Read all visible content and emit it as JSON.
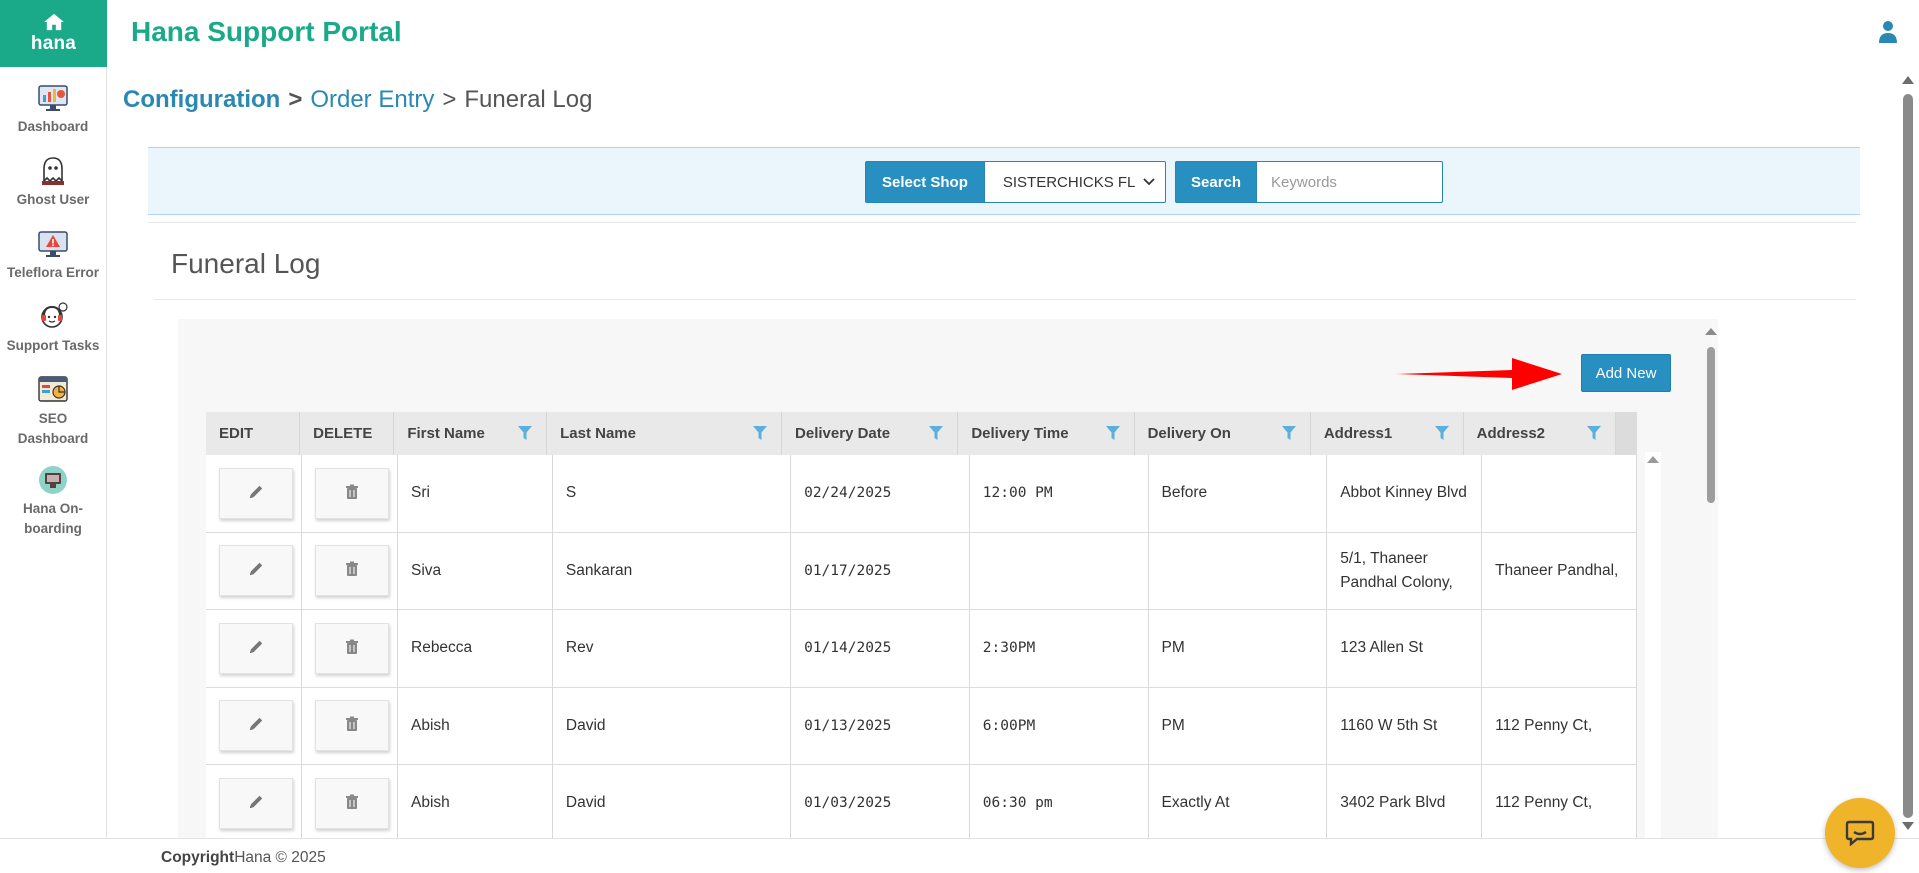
{
  "brand": {
    "name": "hana"
  },
  "sidebar": {
    "items": [
      {
        "label": "Dashboard",
        "icon": "dashboard-icon"
      },
      {
        "label": "Ghost User",
        "icon": "ghost-icon"
      },
      {
        "label": "Teleflora Error",
        "icon": "monitor-error-icon"
      },
      {
        "label": "Support Tasks",
        "icon": "support-icon"
      },
      {
        "label": "SEO Dashboard",
        "icon": "seo-icon"
      },
      {
        "label": "Hana On-boarding",
        "icon": "onboarding-icon"
      }
    ]
  },
  "header": {
    "title": "Hana Support Portal"
  },
  "breadcrumb": {
    "root": "Configuration",
    "sep": ">",
    "link": "Order Entry",
    "current": "Funeral Log"
  },
  "filters": {
    "shop_label": "Select Shop",
    "shop_value": "SISTERCHICKS FL",
    "search_label": "Search",
    "search_placeholder": "Keywords",
    "search_value": ""
  },
  "section": {
    "title": "Funeral Log"
  },
  "actions": {
    "add_new": "Add New"
  },
  "table": {
    "columns": [
      {
        "label": "EDIT",
        "filter": false
      },
      {
        "label": "DELETE",
        "filter": false
      },
      {
        "label": "First Name",
        "filter": true
      },
      {
        "label": "Last Name",
        "filter": true
      },
      {
        "label": "Delivery Date",
        "filter": true
      },
      {
        "label": "Delivery Time",
        "filter": true
      },
      {
        "label": "Delivery On",
        "filter": true
      },
      {
        "label": "Address1",
        "filter": true
      },
      {
        "label": "Address2",
        "filter": true
      }
    ],
    "rows": [
      {
        "first": "Sri",
        "last": "S",
        "date": "02/24/2025",
        "time": "12:00 PM",
        "on": "Before",
        "addr1": "Abbot Kinney Blvd",
        "addr2": ""
      },
      {
        "first": "Siva",
        "last": "Sankaran",
        "date": "01/17/2025",
        "time": "",
        "on": "",
        "addr1": "5/1, Thaneer Pandhal Colony,",
        "addr2": "Thaneer Pandhal,"
      },
      {
        "first": "Rebecca",
        "last": "Rev",
        "date": "01/14/2025",
        "time": "2:30PM",
        "on": "PM",
        "addr1": "123 Allen St",
        "addr2": ""
      },
      {
        "first": "Abish",
        "last": "David",
        "date": "01/13/2025",
        "time": "6:00PM",
        "on": "PM",
        "addr1": "1160 W 5th St",
        "addr2": "112 Penny Ct,"
      },
      {
        "first": "Abish",
        "last": "David",
        "date": "01/03/2025",
        "time": "06:30 pm",
        "on": "Exactly At",
        "addr1": "3402 Park Blvd",
        "addr2": "112 Penny Ct,"
      }
    ]
  },
  "footer": {
    "copyright_label": "Copyright",
    "copyright_text": "Hana © 2025"
  },
  "colors": {
    "brand_green": "#1aa989",
    "primary_blue": "#2790c0",
    "chat_yellow": "#f0b42a"
  }
}
